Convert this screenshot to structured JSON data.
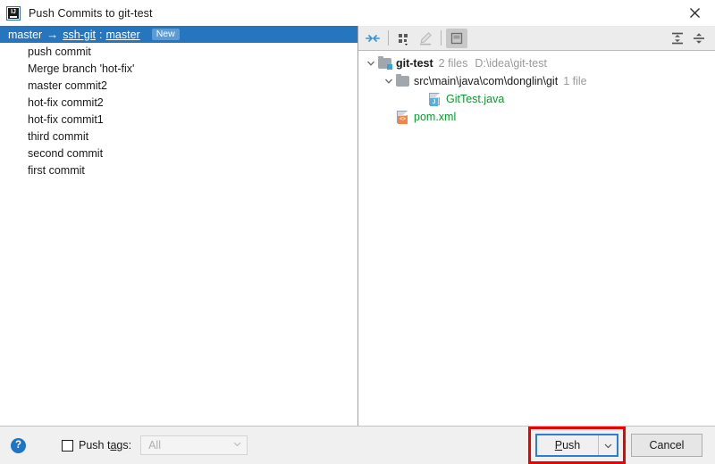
{
  "window": {
    "title": "Push Commits to git-test",
    "app_icon": "intellij-idea-icon",
    "close_label": "✕"
  },
  "commits_pane": {
    "header": {
      "source_branch": "master",
      "arrow": "→",
      "remote": "ssh-git",
      "separator": ":",
      "target_branch": "master",
      "badge": "New"
    },
    "rows": [
      "push commit",
      "Merge branch 'hot-fix'",
      "master commit2",
      "hot-fix commit2",
      "hot-fix commit1",
      "third commit",
      "second commit",
      "first commit"
    ]
  },
  "files_pane": {
    "toolbar": {
      "buttons": [
        {
          "name": "show-diff-icon",
          "title": "Show Diff",
          "state": "enabled"
        },
        {
          "name": "group-by-icon",
          "title": "Group By",
          "state": "enabled"
        },
        {
          "name": "edit-source-icon",
          "title": "Edit Source",
          "state": "disabled"
        },
        {
          "name": "preview-diff-icon",
          "title": "Preview Diff",
          "state": "pressed"
        },
        {
          "name": "expand-all-icon",
          "title": "Expand All",
          "state": "enabled"
        },
        {
          "name": "collapse-all-icon",
          "title": "Collapse All",
          "state": "enabled"
        }
      ]
    },
    "tree": [
      {
        "name": "git-test",
        "icon": "folder-vcs-icon",
        "count": "2 files",
        "path": "D:\\idea\\git-test",
        "expanded": true,
        "depth": 0,
        "color": "black"
      },
      {
        "name": "src\\main\\java\\com\\donglin\\git",
        "icon": "folder-icon",
        "count": "1 file",
        "path": "",
        "expanded": true,
        "depth": 1,
        "color": "black"
      },
      {
        "name": "GitTest.java",
        "icon": "java-file-icon",
        "count": "",
        "path": "",
        "expanded": null,
        "depth": 2,
        "color": "green"
      },
      {
        "name": "pom.xml",
        "icon": "xml-file-icon",
        "count": "",
        "path": "",
        "expanded": null,
        "depth": 1,
        "color": "green"
      }
    ]
  },
  "footer": {
    "help_label": "?",
    "push_tags_label_pre": "Push t",
    "push_tags_label_mnemonic": "a",
    "push_tags_label_post": "gs:",
    "push_tags_checked": false,
    "tags_combo_value": "All",
    "push_button_pre": "P",
    "push_button_mnemonic_done": "P",
    "push_button_post": "ush",
    "cancel_button": "Cancel"
  },
  "colors": {
    "selection_blue": "#2675bf",
    "badge_blue": "#5b9bd6",
    "focus_border": "#2a7fd4",
    "annotation_red": "#ee0000",
    "added_file_green": "#0a9a2e",
    "muted_grey": "#9a9a9a"
  }
}
